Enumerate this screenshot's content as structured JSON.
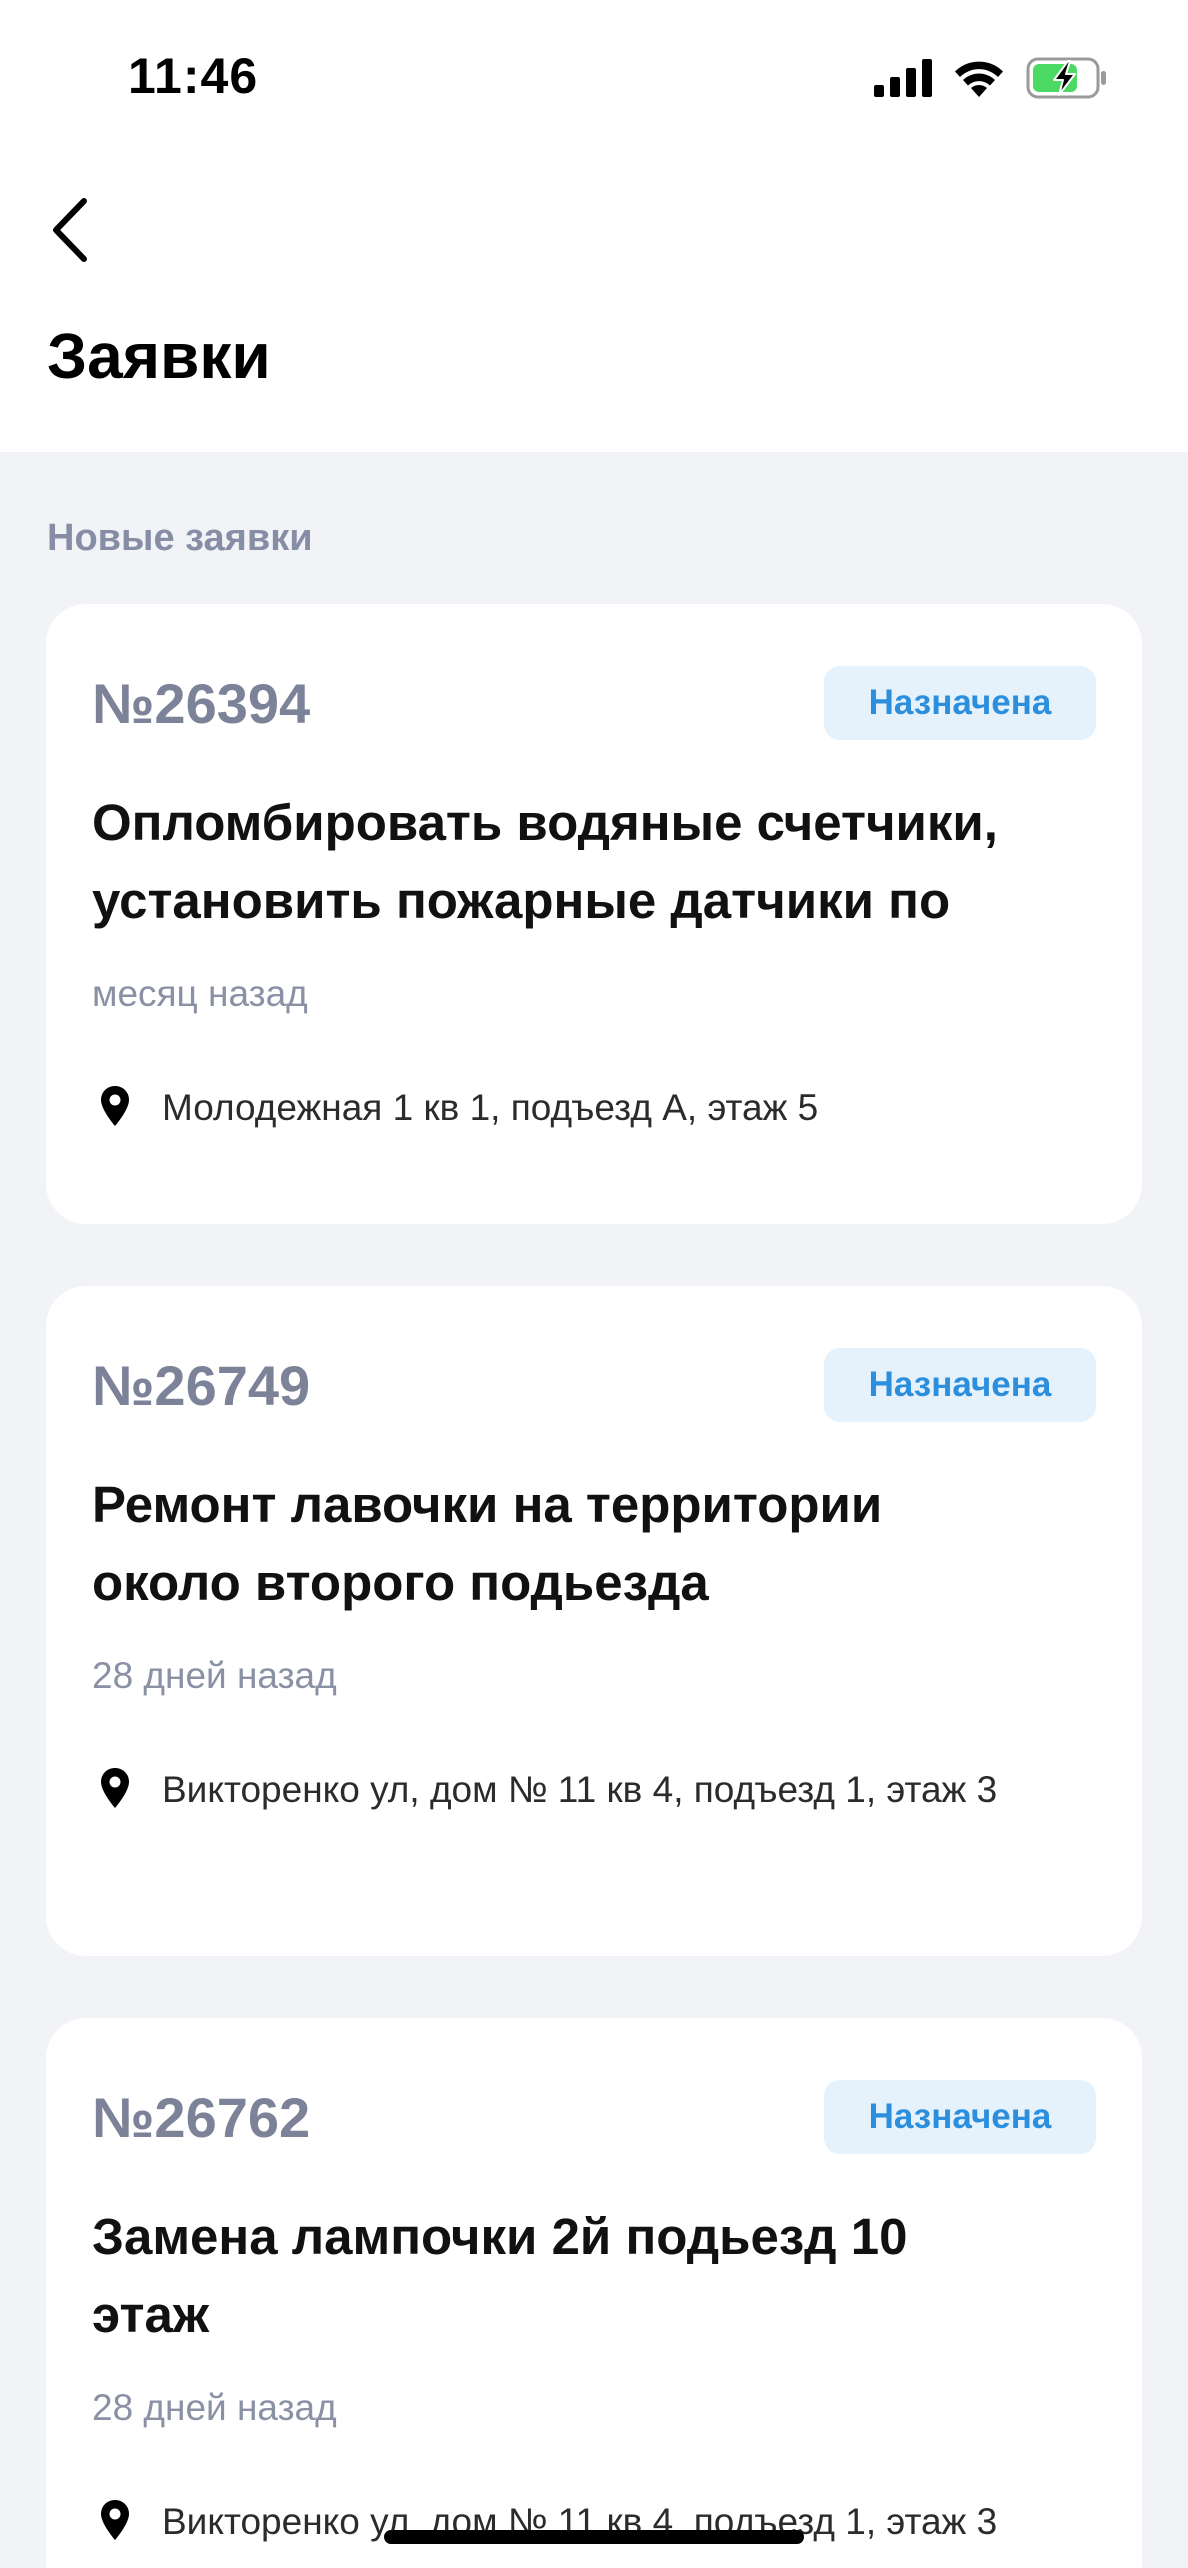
{
  "status_bar": {
    "time": "11:46",
    "icons": [
      "signal-icon",
      "wifi-icon",
      "battery-charging-icon"
    ],
    "battery_color": "#4cd964"
  },
  "header": {
    "back_icon": "chevron-left-icon",
    "title": "Заявки"
  },
  "section": {
    "title": "Новые заявки"
  },
  "colors": {
    "badge_bg": "#e5f1fb",
    "badge_text": "#2c8fde",
    "page_bg": "#f1f3f7",
    "number_text": "#7c8399"
  },
  "requests": [
    {
      "number": "№26394",
      "status": "Назначена",
      "title_lines": [
        "Опломбировать водяные счетчики,",
        "установить пожарные датчики по"
      ],
      "time": "месяц назад",
      "address": "Молодежная 1 кв 1, подъезд А, этаж 5"
    },
    {
      "number": "№26749",
      "status": "Назначена",
      "title_lines": [
        "Ремонт лавочки на территории",
        "около второго подьезда"
      ],
      "time": "28 дней назад",
      "address": "Викторенко ул, дом № 11 кв 4, подъезд 1, этаж 3"
    },
    {
      "number": "№26762",
      "status": "Назначена",
      "title_lines": [
        "Замена лампочки 2й подьезд 10",
        "этаж"
      ],
      "time": "28 дней назад",
      "address": "Викторенко ул, дом № 11 кв 4, подъезд 1, этаж 3"
    }
  ]
}
